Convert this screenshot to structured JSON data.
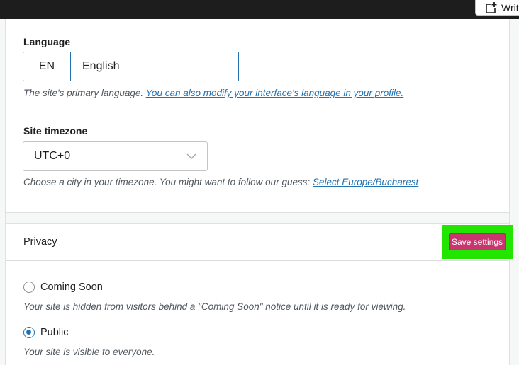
{
  "topbar": {
    "write_label": "Writ",
    "write_icon": "new-post-icon"
  },
  "language": {
    "label": "Language",
    "code": "EN",
    "name": "English",
    "help_text": "The site's primary language. ",
    "help_link": "You can also modify your interface's language in your profile."
  },
  "timezone": {
    "label": "Site timezone",
    "value": "UTC+0",
    "help_text": "Choose a city in your timezone. You might want to follow our guess: ",
    "help_link": "Select Europe/Bucharest"
  },
  "privacy": {
    "title": "Privacy",
    "save_label": "Save settings",
    "options": [
      {
        "label": "Coming Soon",
        "description": "Your site is hidden from visitors behind a \"Coming Soon\" notice until it is ready for viewing.",
        "checked": false
      },
      {
        "label": "Public",
        "description": "Your site is visible to everyone.",
        "checked": true
      }
    ]
  },
  "colors": {
    "accent": "#2271b1",
    "save_button": "#c9356e",
    "highlight": "#22e600"
  }
}
